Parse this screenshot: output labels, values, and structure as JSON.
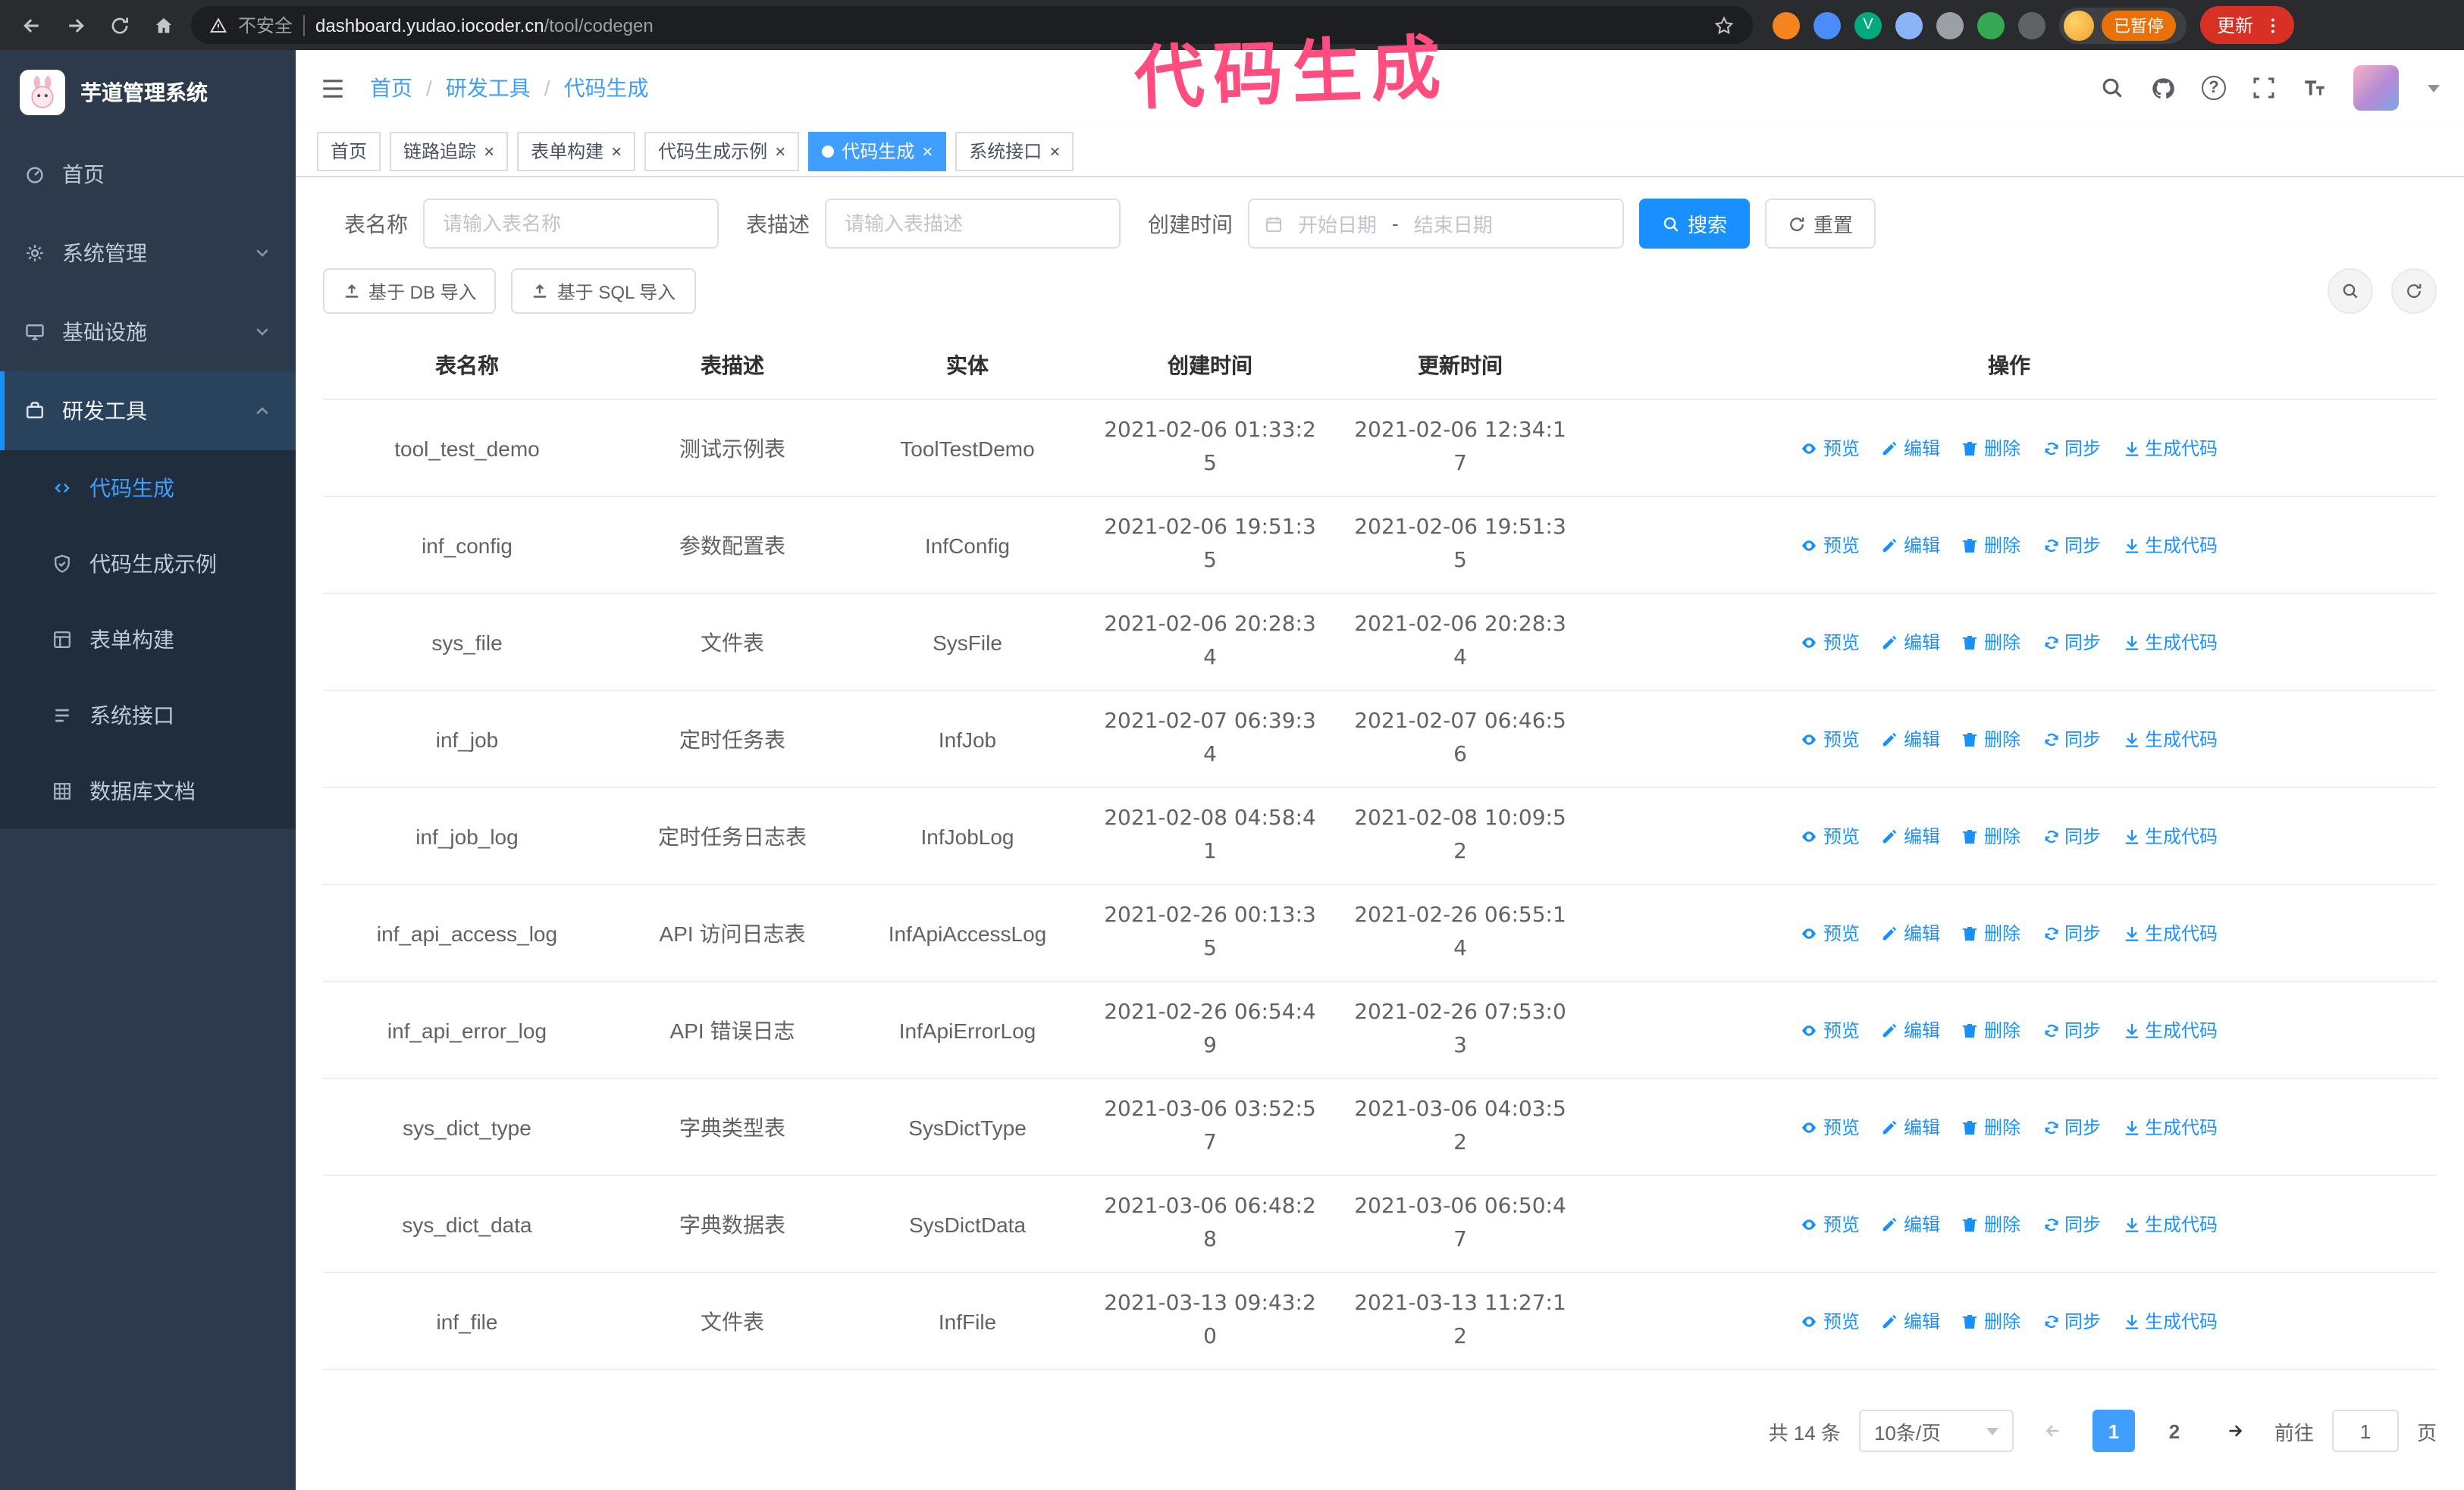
{
  "theme": {
    "accent": "#1890ff",
    "tab_active": "#409eff",
    "link_blue": "#409eff",
    "annotation": "#ff4d7f",
    "sidebar_bg": "#2d3a4b",
    "submenu_bg": "#1f2d3d",
    "badge_paused": "#e8710a",
    "update_red": "#d93025"
  },
  "browser": {
    "security_label": "不安全",
    "url_domain": "dashboard.yudao.iocoder.cn",
    "url_path": "/tool/codegen",
    "profile_badge": "已暂停",
    "update_button": "更新"
  },
  "annotation": {
    "text": "代码生成"
  },
  "sidebar": {
    "logo_title": "芋道管理系统",
    "items": [
      {
        "label": "首页"
      },
      {
        "label": "系统管理"
      },
      {
        "label": "基础设施"
      },
      {
        "label": "研发工具"
      }
    ],
    "submenu": [
      {
        "label": "代码生成"
      },
      {
        "label": "代码生成示例"
      },
      {
        "label": "表单构建"
      },
      {
        "label": "系统接口"
      },
      {
        "label": "数据库文档"
      }
    ]
  },
  "header": {
    "breadcrumb": [
      "首页",
      "研发工具",
      "代码生成"
    ]
  },
  "tabs": [
    {
      "label": "首页"
    },
    {
      "label": "链路追踪"
    },
    {
      "label": "表单构建"
    },
    {
      "label": "代码生成示例"
    },
    {
      "label": "代码生成"
    },
    {
      "label": "系统接口"
    }
  ],
  "filters": {
    "table_name_label": "表名称",
    "table_name_placeholder": "请输入表名称",
    "table_desc_label": "表描述",
    "table_desc_placeholder": "请输入表描述",
    "create_time_label": "创建时间",
    "date_start_placeholder": "开始日期",
    "date_separator": "-",
    "date_end_placeholder": "结束日期",
    "search_button": "搜索",
    "reset_button": "重置"
  },
  "toolbar": {
    "import_db": "基于 DB 导入",
    "import_sql": "基于 SQL 导入"
  },
  "table": {
    "columns": [
      "表名称",
      "表描述",
      "实体",
      "创建时间",
      "更新时间",
      "操作"
    ],
    "ops": [
      "预览",
      "编辑",
      "删除",
      "同步",
      "生成代码"
    ],
    "rows": [
      {
        "name": "tool_test_demo",
        "desc": "测试示例表",
        "entity": "ToolTestDemo",
        "created": "2021-02-06 01:33:25",
        "updated": "2021-02-06 12:34:17"
      },
      {
        "name": "inf_config",
        "desc": "参数配置表",
        "entity": "InfConfig",
        "created": "2021-02-06 19:51:35",
        "updated": "2021-02-06 19:51:35"
      },
      {
        "name": "sys_file",
        "desc": "文件表",
        "entity": "SysFile",
        "created": "2021-02-06 20:28:34",
        "updated": "2021-02-06 20:28:34"
      },
      {
        "name": "inf_job",
        "desc": "定时任务表",
        "entity": "InfJob",
        "created": "2021-02-07 06:39:34",
        "updated": "2021-02-07 06:46:56"
      },
      {
        "name": "inf_job_log",
        "desc": "定时任务日志表",
        "entity": "InfJobLog",
        "created": "2021-02-08 04:58:41",
        "updated": "2021-02-08 10:09:52"
      },
      {
        "name": "inf_api_access_log",
        "desc": "API 访问日志表",
        "entity": "InfApiAccessLog",
        "created": "2021-02-26 00:13:35",
        "updated": "2021-02-26 06:55:14"
      },
      {
        "name": "inf_api_error_log",
        "desc": "API 错误日志",
        "entity": "InfApiErrorLog",
        "created": "2021-02-26 06:54:49",
        "updated": "2021-02-26 07:53:03"
      },
      {
        "name": "sys_dict_type",
        "desc": "字典类型表",
        "entity": "SysDictType",
        "created": "2021-03-06 03:52:57",
        "updated": "2021-03-06 04:03:52"
      },
      {
        "name": "sys_dict_data",
        "desc": "字典数据表",
        "entity": "SysDictData",
        "created": "2021-03-06 06:48:28",
        "updated": "2021-03-06 06:50:47"
      },
      {
        "name": "inf_file",
        "desc": "文件表",
        "entity": "InfFile",
        "created": "2021-03-13 09:43:20",
        "updated": "2021-03-13 11:27:12"
      }
    ]
  },
  "pagination": {
    "total_text": "共 14 条",
    "page_size": "10条/页",
    "pages": [
      "1",
      "2"
    ],
    "goto_label": "前往",
    "goto_value": "1",
    "goto_suffix": "页"
  }
}
